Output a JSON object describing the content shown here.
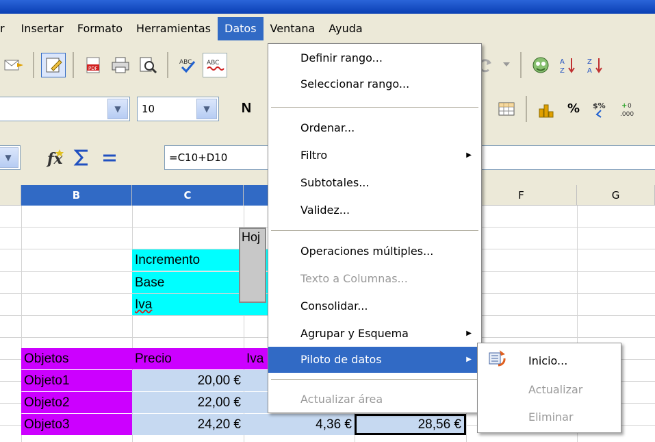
{
  "menubar": {
    "items": [
      "r",
      "Insertar",
      "Formato",
      "Herramientas",
      "Datos",
      "Ventana",
      "Ayuda"
    ]
  },
  "toolbar": {
    "font_size": "10",
    "bold_label": "N",
    "formula_value": "=C10+D10"
  },
  "columns": [
    "B",
    "C",
    "F",
    "G"
  ],
  "cells": {
    "hoj": "Hoj",
    "incremento": "Incremento",
    "base": "Base",
    "iva": "Iva",
    "objetos": "Objetos",
    "precio": "Precio",
    "iva_header": "Iva",
    "objeto1": "Objeto1",
    "objeto2": "Objeto2",
    "objeto3": "Objeto3",
    "precio1": "20,00 €",
    "precio2": "22,00 €",
    "precio3": "24,20 €",
    "iva3": "4,36 €",
    "total3": "28,56 €"
  },
  "datos_menu": {
    "items": [
      "Definir rango...",
      "Seleccionar rango...",
      "Ordenar...",
      "Filtro",
      "Subtotales...",
      "Validez...",
      "Operaciones múltiples...",
      "Texto a Columnas...",
      "Consolidar...",
      "Agrupar y Esquema",
      "Piloto de datos",
      "Actualizar área"
    ]
  },
  "submenu": {
    "items": [
      "Inicio...",
      "Actualizar",
      "Eliminar"
    ]
  }
}
